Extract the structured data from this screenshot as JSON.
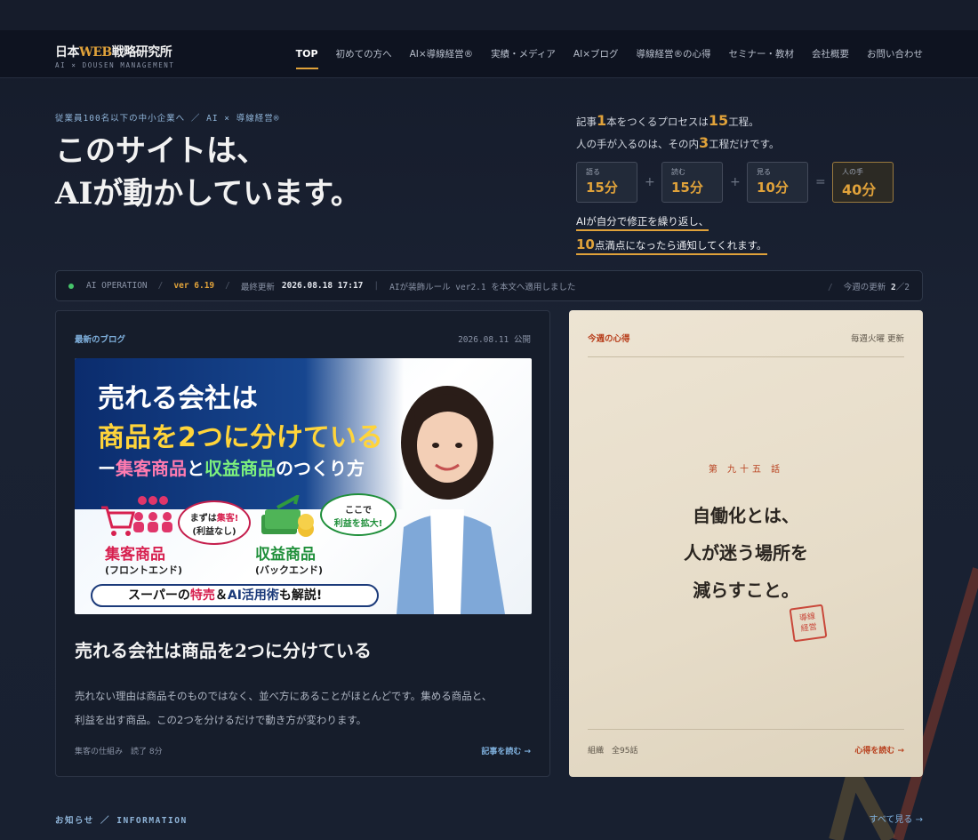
{
  "header": {
    "logo_pre": "日本",
    "logo_web": "WEB",
    "logo_post": "戦略研究所",
    "logo_sub": "AI × DOUSEN MANAGEMENT",
    "nav": [
      "TOP",
      "初めての方へ",
      "AI×導線経営®",
      "実績・メディア",
      "AI×ブログ",
      "導線経営®の心得",
      "セミナー・教材",
      "会社概要",
      "お問い合わせ"
    ]
  },
  "hero": {
    "tag": "従業員100名以下の中小企業へ ／ AI × 導線経営®",
    "title_line1": "このサイトは、",
    "title_line2": "AIが動かしています。"
  },
  "process": {
    "l1_a": "記事",
    "l1_n1": "1",
    "l1_b": "本をつくるプロセスは",
    "l1_n2": "15",
    "l1_c": "工程。",
    "l2_a": "人の手が入るのは、その内",
    "l2_n": "3",
    "l2_b": "工程だけです。",
    "steps": [
      {
        "label": "語る",
        "value": "15分"
      },
      {
        "label": "読む",
        "value": "15分"
      },
      {
        "label": "見る",
        "value": "10分"
      },
      {
        "label": "人の手",
        "value": "40分"
      }
    ],
    "ops": [
      "+",
      "+",
      "="
    ],
    "note1": "AIが自分で修正を繰り返し、",
    "note2_n": "10",
    "note2": "点満点になったら通知してくれます。"
  },
  "opbar": {
    "label": "AI OPERATION",
    "version": "ver 6.19",
    "updated_label": "最終更新",
    "updated_time": "2026.08.18 17:17",
    "message": "AIが装飾ルール ver2.1 を本文へ適用しました",
    "weekly_label": "今週の更新",
    "weekly_value": "2",
    "weekly_total": "／2"
  },
  "blog": {
    "label": "最新のブログ",
    "date": "2026.08.11 公開",
    "img_t1": "売れる会社は",
    "img_t2": "商品を2つに分けている",
    "img_t3_a": "ー",
    "img_t3_b": "集客商品",
    "img_t3_c": "と",
    "img_t3_d": "収益商品",
    "img_t3_e": "のつくり方",
    "img_bubble1_a": "まずは",
    "img_bubble1_b": "集客!",
    "img_bubble1_c": "(利益なし)",
    "img_bubble2_a": "ここで",
    "img_bubble2_b": "利益を拡大!",
    "img_lab1": "集客商品",
    "img_lab1_sub": "(フロントエンド)",
    "img_lab2": "収益商品",
    "img_lab2_sub": "(バックエンド)",
    "img_bar_a": "スーパーの",
    "img_bar_b": "特売",
    "img_bar_c": "＆",
    "img_bar_d": "AI活用術",
    "img_bar_e": "も解説!",
    "title": "売れる会社は商品を2つに分けている",
    "desc": "売れない理由は商品そのものではなく、並べ方にあることがほとんどです。集める商品と、利益を出す商品。この2つを分けるだけで動き方が変わります。",
    "meta": "集客の仕組み　読了 8分",
    "link": "記事を読む →"
  },
  "mind": {
    "label": "今週の心得",
    "schedule": "毎週火曜 更新",
    "episode": "第 九十五 話",
    "quote1": "自働化とは、",
    "quote2": "人が迷う場所を",
    "quote3": "減らすこと。",
    "seal1": "導線",
    "seal2": "経営",
    "foot": "組織　全95話",
    "link": "心得を読む →"
  },
  "info": {
    "label": "お知らせ ／ INFORMATION",
    "see_all": "すべて見る →"
  }
}
